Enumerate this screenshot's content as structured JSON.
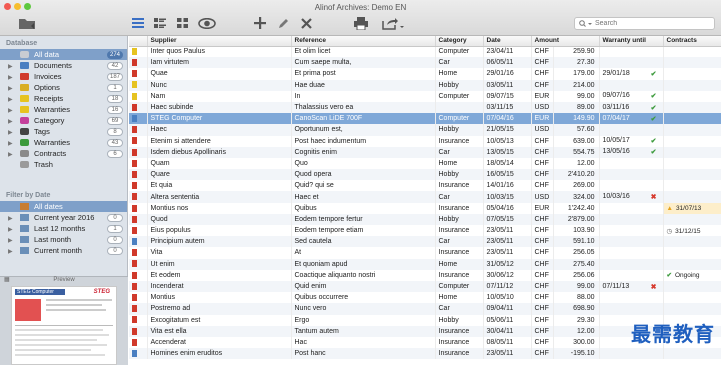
{
  "window": {
    "title": "Alinof Archives: Demo EN"
  },
  "toolbar": {
    "icons": [
      "folder-icon",
      "list-view-icon",
      "detail-view-icon",
      "grid-view-icon",
      "eye-icon",
      "plus-icon",
      "pencil-icon",
      "cross-icon",
      "print-icon",
      "share-icon"
    ],
    "search_placeholder": "Search"
  },
  "sidebar": {
    "database_header": "Database",
    "items": [
      {
        "label": "All data",
        "count": "274",
        "icon": "database-icon",
        "color": "#c8ccd2",
        "selected": true
      },
      {
        "label": "Documents",
        "count": "42",
        "icon": "folder-icon",
        "color": "#4a7fc1"
      },
      {
        "label": "Invoices",
        "count": "187",
        "icon": "folder-icon",
        "color": "#d0392b"
      },
      {
        "label": "Options",
        "count": "1",
        "icon": "folder-icon",
        "color": "#d9ae24"
      },
      {
        "label": "Receipts",
        "count": "18",
        "icon": "folder-icon",
        "color": "#e6c320"
      },
      {
        "label": "Warranties",
        "count": "16",
        "icon": "folder-icon",
        "color": "#e6c320"
      },
      {
        "label": "Category",
        "count": "69",
        "icon": "category-icon",
        "color": "#c43f9b"
      },
      {
        "label": "Tags",
        "count": "8",
        "icon": "tag-icon",
        "color": "#444444"
      },
      {
        "label": "Warranties",
        "count": "43",
        "icon": "warranty-check-icon",
        "color": "#3c9a3c"
      },
      {
        "label": "Contracts",
        "count": "6",
        "icon": "contract-icon",
        "color": "#8a8a8a"
      },
      {
        "label": "Trash",
        "count": "",
        "icon": "trash-icon",
        "color": "#9a9a9a"
      }
    ],
    "date_header": "Filter by Date",
    "date_items": [
      {
        "label": "All dates",
        "count": "",
        "selected": true
      },
      {
        "label": "Current year 2016",
        "count": "0"
      },
      {
        "label": "Last 12 months",
        "count": "1"
      },
      {
        "label": "Last month",
        "count": "0"
      },
      {
        "label": "Current month",
        "count": "0"
      }
    ],
    "preview_label": "Preview",
    "preview_doc": {
      "title": "STEG Computer",
      "brand": "STEG"
    }
  },
  "table": {
    "columns": [
      "Supplier",
      "Reference",
      "Category",
      "Date",
      "Amount",
      "Warranty until",
      "Contracts"
    ],
    "rows": [
      {
        "flag": "#e6c320",
        "supplier": "Inter quos Paulus",
        "reference": "Et olim licet",
        "category": "Computer",
        "date": "23/04/11",
        "currency": "CHF",
        "amount": "259.90",
        "warranty": "",
        "w_status": "",
        "contract": ""
      },
      {
        "flag": "#d0392b",
        "supplier": "Iam virtutem",
        "reference": "Cum saepe multa,",
        "category": "Car",
        "date": "06/05/11",
        "currency": "CHF",
        "amount": "27.30",
        "warranty": "",
        "w_status": "",
        "contract": ""
      },
      {
        "flag": "#d0392b",
        "supplier": "Quae",
        "reference": "Et prima post",
        "category": "Home",
        "date": "29/01/16",
        "currency": "CHF",
        "amount": "179.00",
        "warranty": "29/01/18",
        "w_status": "ok",
        "contract": ""
      },
      {
        "flag": "#e6c320",
        "supplier": "Nunc",
        "reference": "Hae duae",
        "category": "Hobby",
        "date": "03/05/11",
        "currency": "CHF",
        "amount": "214.00",
        "warranty": "",
        "w_status": "",
        "contract": ""
      },
      {
        "flag": "#e6c320",
        "supplier": "Nam",
        "reference": "In",
        "category": "Computer",
        "date": "09/07/15",
        "currency": "EUR",
        "amount": "99.00",
        "warranty": "09/07/16",
        "w_status": "ok",
        "contract": ""
      },
      {
        "flag": "#d0392b",
        "supplier": "Haec subinde",
        "reference": "Thalassius vero ea",
        "category": "",
        "date": "03/11/15",
        "currency": "USD",
        "amount": "89.00",
        "warranty": "03/11/16",
        "w_status": "ok",
        "contract": ""
      },
      {
        "flag": "#4a7fc1",
        "supplier": "STEG Computer",
        "reference": "CanoScan LiDE 700F",
        "category": "Computer",
        "date": "07/04/16",
        "currency": "EUR",
        "amount": "149.90",
        "warranty": "07/04/17",
        "w_status": "ok",
        "contract": "",
        "selected": true
      },
      {
        "flag": "#d0392b",
        "supplier": "Haec",
        "reference": "Oportunum est,",
        "category": "Hobby",
        "date": "21/05/15",
        "currency": "USD",
        "amount": "57.60",
        "warranty": "",
        "w_status": "",
        "contract": ""
      },
      {
        "flag": "#d0392b",
        "supplier": "Etenim si attendere",
        "reference": "Post haec indumentum",
        "category": "Insurance",
        "date": "10/05/13",
        "currency": "CHF",
        "amount": "639.00",
        "warranty": "10/05/17",
        "w_status": "ok",
        "contract": ""
      },
      {
        "flag": "#d0392b",
        "supplier": "Isdem diebus Apollinaris",
        "reference": "Cognitis enim",
        "category": "Car",
        "date": "13/05/15",
        "currency": "CHF",
        "amount": "554.75",
        "warranty": "13/05/16",
        "w_status": "ok",
        "contract": ""
      },
      {
        "flag": "#d0392b",
        "supplier": "Quam",
        "reference": "Quo",
        "category": "Home",
        "date": "18/05/14",
        "currency": "CHF",
        "amount": "12.00",
        "warranty": "",
        "w_status": "",
        "contract": ""
      },
      {
        "flag": "#d0392b",
        "supplier": "Quare",
        "reference": "Quod opera",
        "category": "Hobby",
        "date": "16/05/15",
        "currency": "CHF",
        "amount": "2'410.20",
        "warranty": "",
        "w_status": "",
        "contract": ""
      },
      {
        "flag": "#d0392b",
        "supplier": "Et quia",
        "reference": "Quid? qui se",
        "category": "Insurance",
        "date": "14/01/16",
        "currency": "CHF",
        "amount": "269.00",
        "warranty": "",
        "w_status": "",
        "contract": ""
      },
      {
        "flag": "#d0392b",
        "supplier": "Altera sententia",
        "reference": "Haec et",
        "category": "Car",
        "date": "10/03/15",
        "currency": "USD",
        "amount": "324.00",
        "warranty": "10/03/16",
        "w_status": "bad",
        "contract": ""
      },
      {
        "flag": "#d0392b",
        "supplier": "Montius nos",
        "reference": "Quibus",
        "category": "Insurance",
        "date": "05/04/16",
        "currency": "EUR",
        "amount": "1'242.40",
        "warranty": "",
        "w_status": "",
        "contract": "31/07/13",
        "c_status": "warn"
      },
      {
        "flag": "#d0392b",
        "supplier": "Quod",
        "reference": "Eodem tempore fertur",
        "category": "Hobby",
        "date": "07/05/15",
        "currency": "CHF",
        "amount": "2'879.00",
        "warranty": "",
        "w_status": "",
        "contract": ""
      },
      {
        "flag": "#d0392b",
        "supplier": "Eius populus",
        "reference": "Eodem tempore etiam",
        "category": "Insurance",
        "date": "23/05/11",
        "currency": "CHF",
        "amount": "103.90",
        "warranty": "",
        "w_status": "",
        "contract": "31/12/15",
        "c_status": "clock"
      },
      {
        "flag": "#4a7fc1",
        "supplier": "Principium autem",
        "reference": "Sed cautela",
        "category": "Car",
        "date": "23/05/11",
        "currency": "CHF",
        "amount": "591.10",
        "warranty": "",
        "w_status": "",
        "contract": ""
      },
      {
        "flag": "#d0392b",
        "supplier": "Vita",
        "reference": "At",
        "category": "Insurance",
        "date": "23/05/11",
        "currency": "CHF",
        "amount": "256.05",
        "warranty": "",
        "w_status": "",
        "contract": ""
      },
      {
        "flag": "#d0392b",
        "supplier": "Ut enim",
        "reference": "Et quoniam apud",
        "category": "Home",
        "date": "31/05/12",
        "currency": "CHF",
        "amount": "275.40",
        "warranty": "",
        "w_status": "",
        "contract": ""
      },
      {
        "flag": "#d0392b",
        "supplier": "Et eodem",
        "reference": "Coactique aliquanto nostri",
        "category": "Insurance",
        "date": "30/06/12",
        "currency": "CHF",
        "amount": "256.06",
        "warranty": "",
        "w_status": "",
        "contract": "Ongoing",
        "c_status": "ok"
      },
      {
        "flag": "#d0392b",
        "supplier": "Incenderat",
        "reference": "Quid enim",
        "category": "Computer",
        "date": "07/11/12",
        "currency": "CHF",
        "amount": "99.00",
        "warranty": "07/11/13",
        "w_status": "bad",
        "contract": ""
      },
      {
        "flag": "#d0392b",
        "supplier": "Montius",
        "reference": "Quibus occurrere",
        "category": "Home",
        "date": "10/05/10",
        "currency": "CHF",
        "amount": "88.00",
        "warranty": "",
        "w_status": "",
        "contract": ""
      },
      {
        "flag": "#d0392b",
        "supplier": "Postremo ad",
        "reference": "Nunc vero",
        "category": "Car",
        "date": "09/04/11",
        "currency": "CHF",
        "amount": "698.90",
        "warranty": "",
        "w_status": "",
        "contract": ""
      },
      {
        "flag": "#d0392b",
        "supplier": "Excogitatum est",
        "reference": "Ergo",
        "category": "Hobby",
        "date": "05/06/11",
        "currency": "CHF",
        "amount": "29.30",
        "warranty": "",
        "w_status": "",
        "contract": ""
      },
      {
        "flag": "#d0392b",
        "supplier": "Vita est ella",
        "reference": "Tantum autem",
        "category": "Insurance",
        "date": "30/04/11",
        "currency": "CHF",
        "amount": "12.00",
        "warranty": "",
        "w_status": "",
        "contract": ""
      },
      {
        "flag": "#d0392b",
        "supplier": "Accenderat",
        "reference": "Hac",
        "category": "Insurance",
        "date": "08/05/11",
        "currency": "CHF",
        "amount": "300.00",
        "warranty": "",
        "w_status": "",
        "contract": ""
      },
      {
        "flag": "#4a7fc1",
        "supplier": "Homines enim eruditos",
        "reference": "Post hanc",
        "category": "Insurance",
        "date": "23/05/11",
        "currency": "CHF",
        "amount": "-195.10",
        "warranty": "",
        "w_status": "",
        "contract": ""
      }
    ]
  },
  "watermark": "最需教育"
}
